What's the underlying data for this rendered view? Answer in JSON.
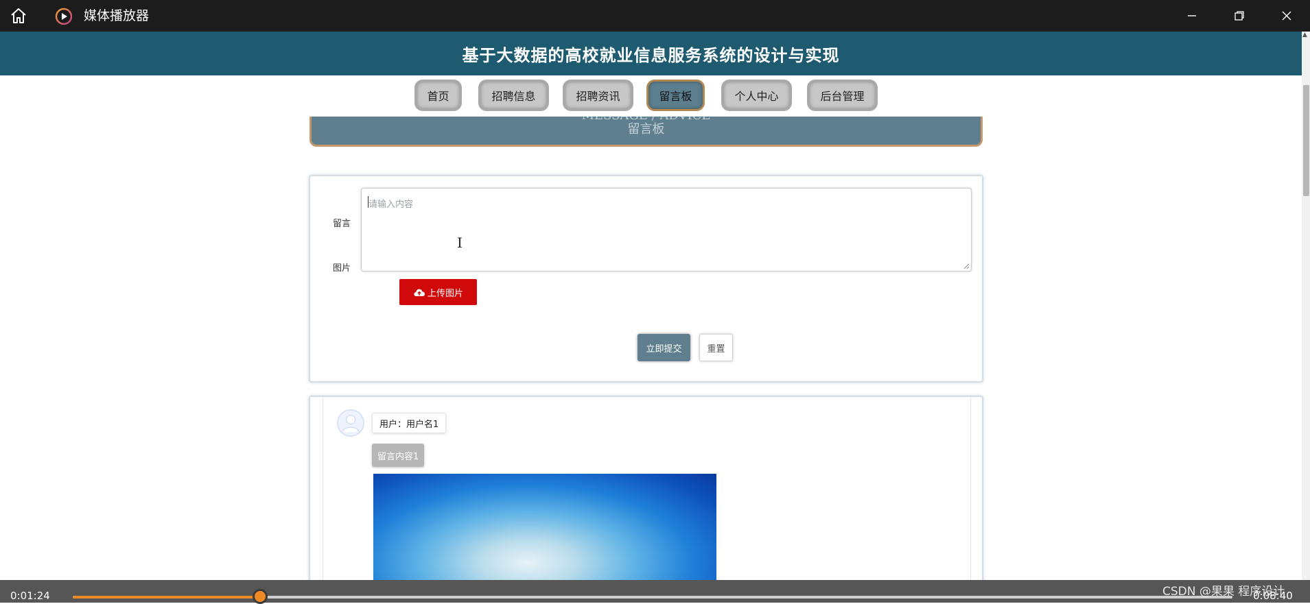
{
  "window": {
    "title": "媒体播放器"
  },
  "page": {
    "header_title": "基于大数据的高校就业信息服务系统的设计与实现",
    "nav": [
      {
        "label": "首页",
        "active": false
      },
      {
        "label": "招聘信息",
        "active": false
      },
      {
        "label": "招聘资讯",
        "active": false
      },
      {
        "label": "留言板",
        "active": true
      },
      {
        "label": "个人中心",
        "active": false
      },
      {
        "label": "后台管理",
        "active": false
      }
    ],
    "banner": {
      "en": "MESSAGE / ADVICE",
      "cn": "留言板"
    },
    "form": {
      "message_label": "留言",
      "message_placeholder": "请输入内容",
      "message_value": "",
      "image_label": "图片",
      "upload_label": "上传图片",
      "submit_label": "立即提交",
      "reset_label": "重置"
    },
    "messages": [
      {
        "user_text": "用户：用户名1",
        "content": "留言内容1"
      }
    ]
  },
  "media": {
    "current_time": "0:01:24",
    "total_time": "0:08:40",
    "progress": 0.1615,
    "watermark": "CSDN @果果 程序设计",
    "accent_color": "#f08a24"
  }
}
